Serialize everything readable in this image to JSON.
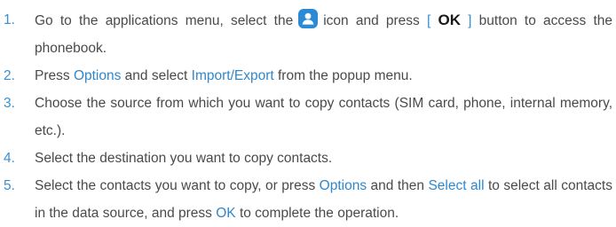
{
  "steps": [
    {
      "num": "1.",
      "before_icon": "Go to the applications menu, select the",
      "icon": "contact-person-icon",
      "after_icon": "icon and press",
      "bracket_open": "[",
      "key": "OK",
      "bracket_close": "]",
      "tail": "button to access the phonebook."
    },
    {
      "num": "2.",
      "t1": "Press",
      "h1": "Options",
      "t2": "and select",
      "h2": "Import/Export",
      "t3": "from the popup menu."
    },
    {
      "num": "3.",
      "text": "Choose the source from which you want to copy contacts (SIM card, phone, internal memory, etc.)."
    },
    {
      "num": "4.",
      "text": "Select the destination you want to copy contacts."
    },
    {
      "num": "5.",
      "t1": "Select the contacts you want to copy, or press",
      "h1": "Options",
      "t2": "and then",
      "h2": "Select all",
      "t3": "to select all contacts in the data source, and press",
      "h3": "OK",
      "t4": "to complete the operation."
    }
  ],
  "colors": {
    "number": "#3a8fd0",
    "highlight": "#2f87cc",
    "body_text": "#4a4a4a",
    "icon_bg": "#2b8ad6"
  }
}
